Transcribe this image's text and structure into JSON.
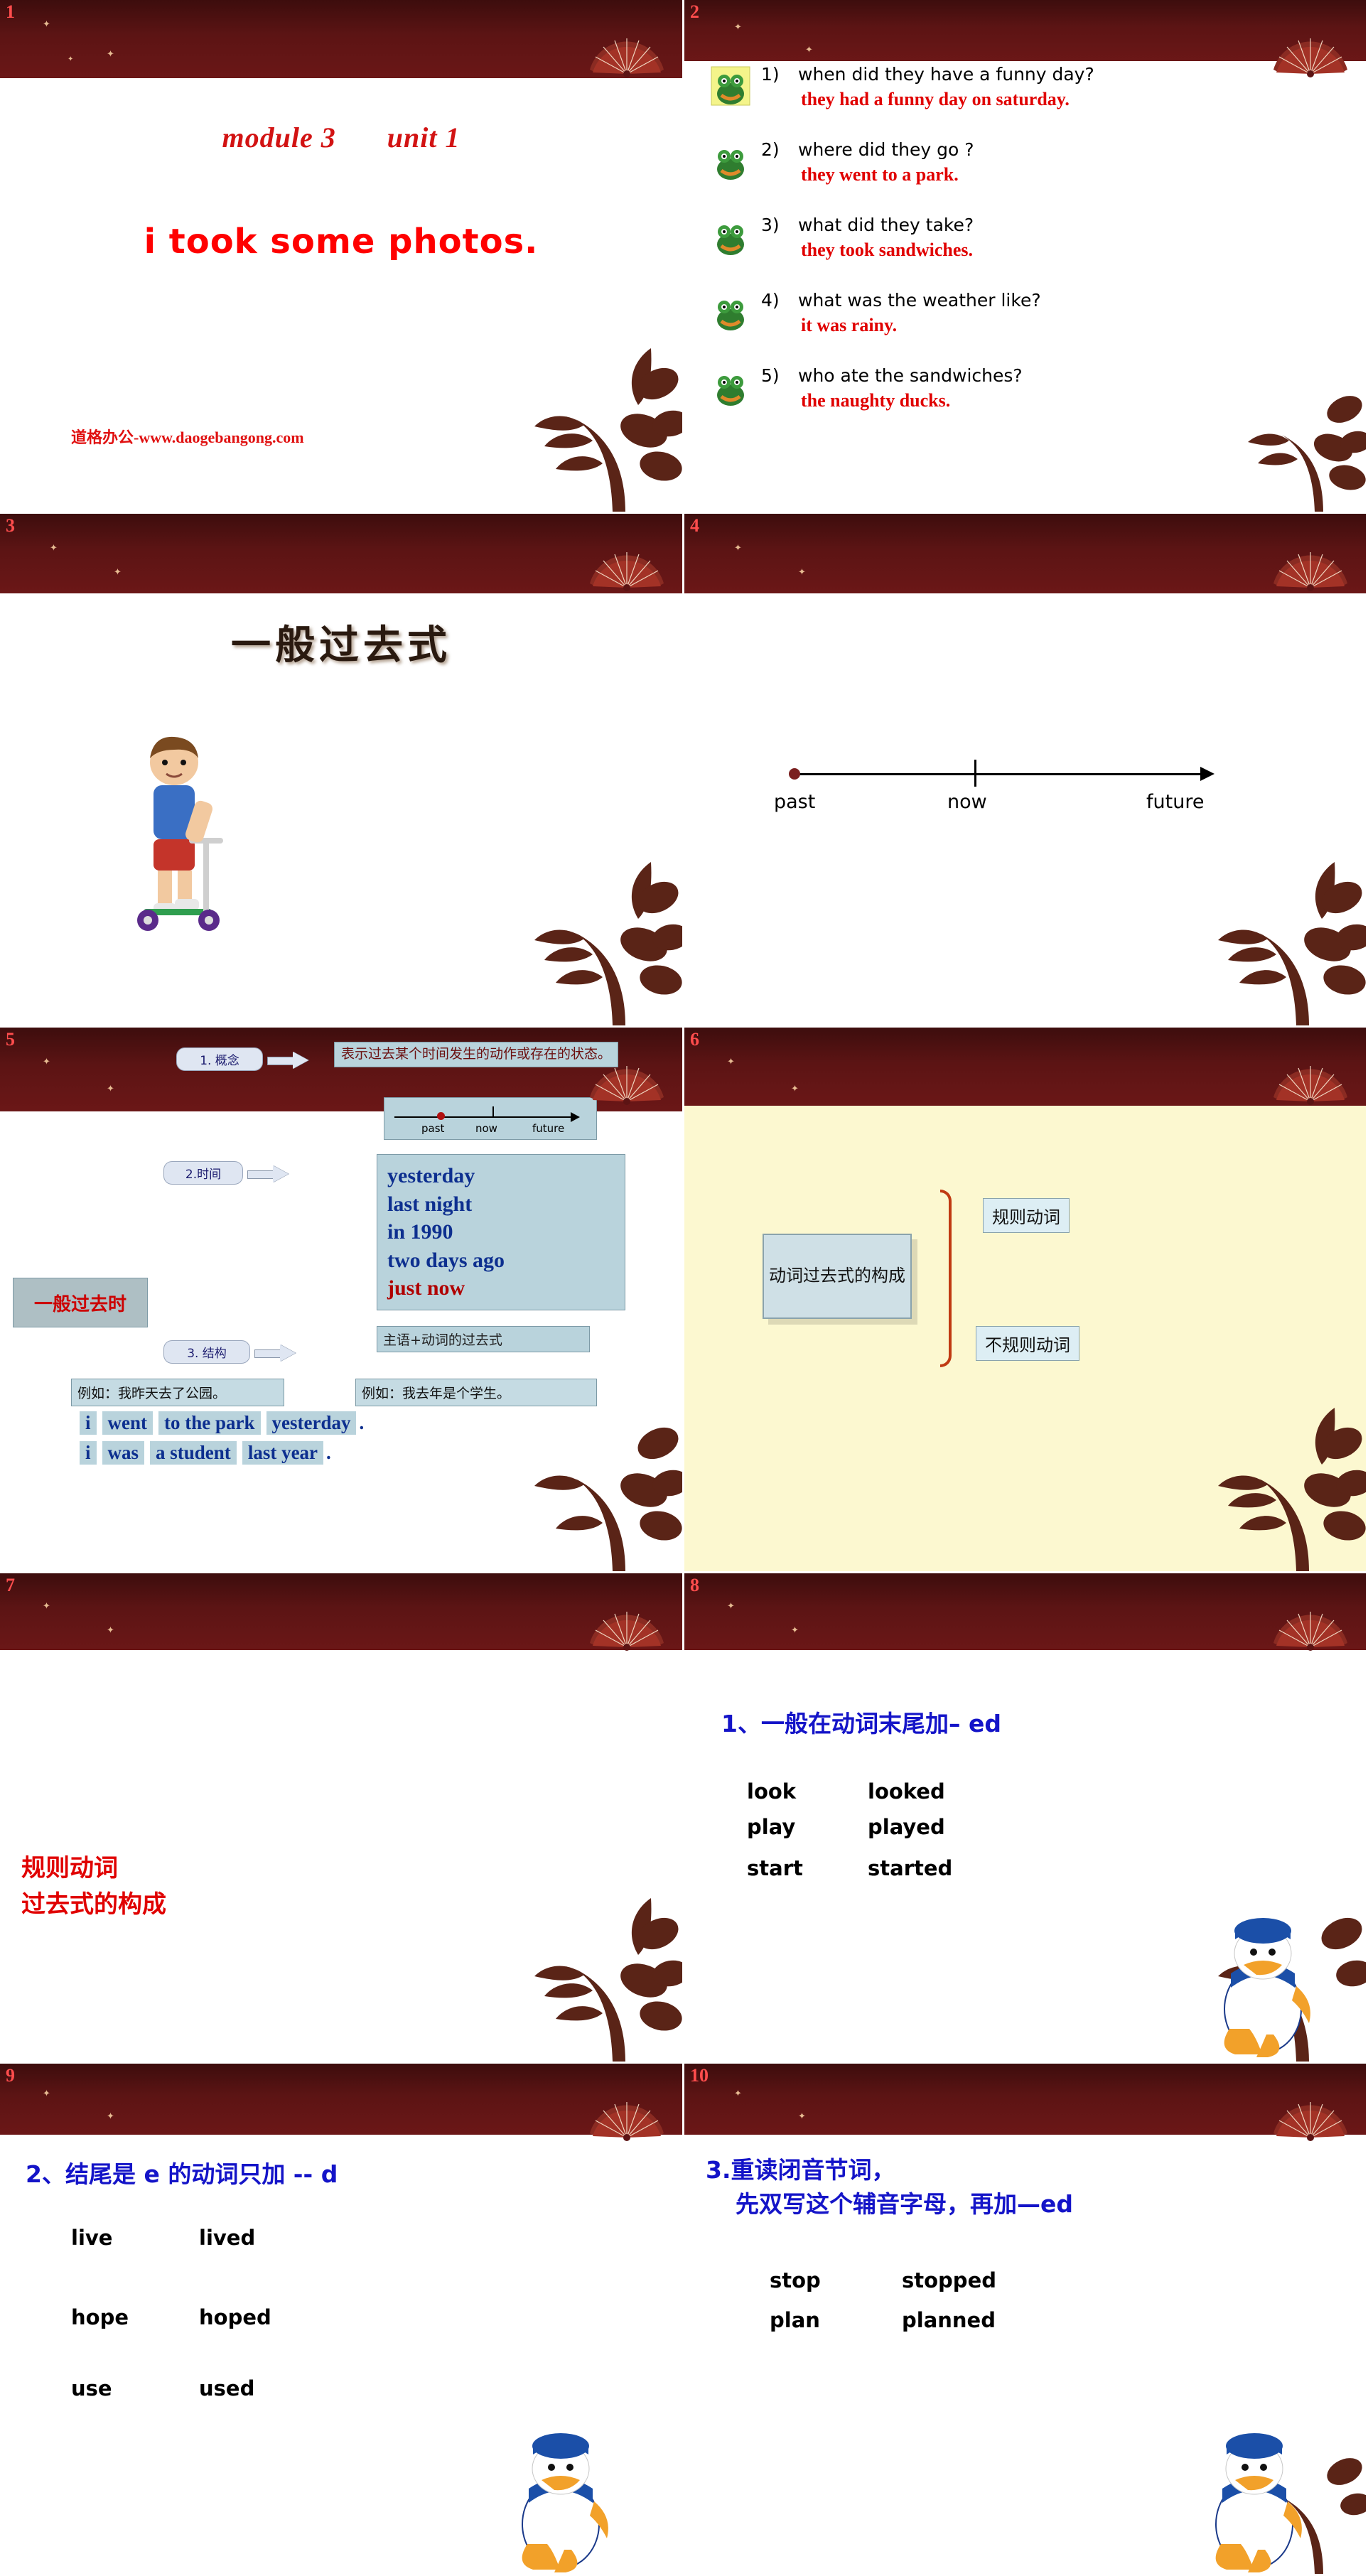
{
  "deck": {
    "slides": [
      {
        "number": "1"
      },
      {
        "number": "2"
      },
      {
        "number": "3"
      },
      {
        "number": "4"
      },
      {
        "number": "5"
      },
      {
        "number": "6"
      },
      {
        "number": "7"
      },
      {
        "number": "8"
      },
      {
        "number": "9"
      },
      {
        "number": "10"
      }
    ]
  },
  "slide1": {
    "module": "module 3",
    "unit": "unit 1",
    "title": "i took some photos.",
    "watermark": "道格办公-www.daogebangong.com"
  },
  "slide2": {
    "items": [
      {
        "num": "1)",
        "question": "when did they have a funny day?",
        "answer": "they had a funny day on saturday."
      },
      {
        "num": "2)",
        "question": "where did they go ?",
        "answer": "they went to a park."
      },
      {
        "num": "3)",
        "question": "what did they take?",
        "answer": "they took sandwiches."
      },
      {
        "num": "4)",
        "question": "what was the weather like?",
        "answer": "it was rainy."
      },
      {
        "num": "5)",
        "question": "who ate the sandwiches?",
        "answer": "the naughty ducks."
      }
    ]
  },
  "slide3": {
    "title": "一般过去式"
  },
  "slide4": {
    "timeline": {
      "past": "past",
      "now": "now",
      "future": "future"
    }
  },
  "slide5": {
    "main_label": "一般过去时",
    "node1": "1. 概念",
    "node2": "2.时间",
    "node3": "3. 结构",
    "definition": "表示过去某个时间发生的动作或存在的状态。",
    "mini_timeline": {
      "past": "past",
      "now": "now",
      "future": "future"
    },
    "time_words": [
      "yesterday",
      "last night",
      "in 1990",
      "two days ago"
    ],
    "just_now": "just now",
    "structure": "主语+动词的过去式",
    "example1_label": "例如：我昨天去了公园。",
    "example2_label": "例如：我去年是个学生。",
    "sentence1": [
      "i",
      "went",
      "to the park",
      "yesterday",
      "."
    ],
    "sentence2": [
      "i",
      "was",
      "a student",
      "last year",
      "."
    ]
  },
  "slide6": {
    "box": "动词过去式的构成",
    "items": [
      "规则动词",
      "不规则动词"
    ]
  },
  "slide7": {
    "line1": "规则动词",
    "line2": "过去式的构成"
  },
  "slide8": {
    "rule": "1、一般在动词末尾加– ed",
    "pairs": [
      {
        "base": "look",
        "past": "looked"
      },
      {
        "base": "play",
        "past": "played"
      },
      {
        "base": "start",
        "past": "started"
      }
    ]
  },
  "slide9": {
    "rule": "2、结尾是 e  的动词只加 -- d",
    "pairs": [
      {
        "base": "live",
        "past": "lived"
      },
      {
        "base": "hope",
        "past": "hoped"
      },
      {
        "base": "use",
        "past": "used"
      }
    ]
  },
  "slide10": {
    "rule_line1": "3.重读闭音节词，",
    "rule_line2": "先双写这个辅音字母，再加—ed",
    "pairs": [
      {
        "base": "stop",
        "past": "stopped"
      },
      {
        "base": "plan",
        "past": "planned"
      }
    ]
  }
}
